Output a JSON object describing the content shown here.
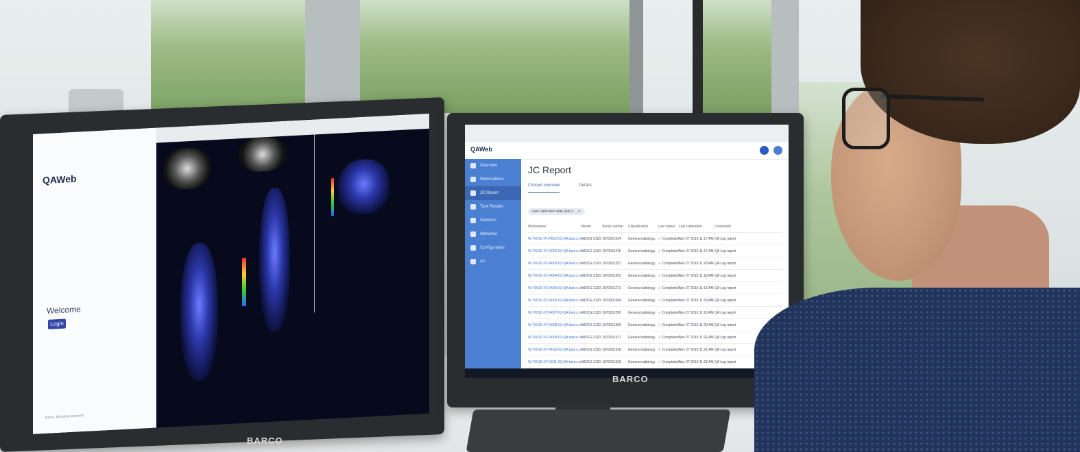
{
  "left_monitor": {
    "app_logo": "QAWeb",
    "welcome": "Welcome",
    "login_button": "Login",
    "footer": "Barco. All rights reserved.",
    "brand": "BARCO"
  },
  "right_monitor": {
    "app_logo": "QAWeb",
    "page_title": "JC Report",
    "brand": "BARCO",
    "tabs": [
      {
        "label": "Content overview"
      },
      {
        "label": "Details"
      }
    ],
    "filter_chip": "Last calibration date (last 3 ... ✕",
    "sidebar": [
      "Overview",
      "Workstations",
      "JC Report",
      "Task Results",
      "Statistics",
      "Networks",
      "Configuration",
      "All"
    ],
    "table": {
      "columns": [
        "Workstation",
        "Model",
        "Serial number",
        "Classification",
        "Last status",
        "Last calibration",
        "Comments"
      ],
      "rows": [
        [
          "W-T001D-0714001-03-QA.barco.org",
          "MDCG-3120",
          "1070001234",
          "General radiology",
          "✓ Completed",
          "Nov 27 2019 11:17 AM",
          "QA Log report"
        ],
        [
          "W-T001D-0714002-03-QA.barco.org",
          "MDCG-3120",
          "1070001240",
          "General radiology",
          "✓ Completed",
          "Nov 27 2019 11:17 AM",
          "QA Log report"
        ],
        [
          "W-T001D-0714003-03-QA.barco.org",
          "MDCG-3120",
          "1070001251",
          "General radiology",
          "✓ Completed",
          "Nov 27 2019 11:18 AM",
          "QA Log report"
        ],
        [
          "W-T001D-0714004-03-QA.barco.org",
          "MDCG-3120",
          "1070001262",
          "General radiology",
          "✓ Completed",
          "Nov 27 2019 11:18 AM",
          "QA Log report"
        ],
        [
          "W-T001D-0714005-03-QA.barco.org",
          "MDCG-3120",
          "1070001273",
          "General radiology",
          "✓ Completed",
          "Nov 27 2019 11:19 AM",
          "QA Log report"
        ],
        [
          "W-T001D-0714006-03-QA.barco.org",
          "MDCG-3120",
          "1070001284",
          "General radiology",
          "✓ Completed",
          "Nov 27 2019 11:19 AM",
          "QA Log report"
        ],
        [
          "W-T001D-0714007-03-QA.barco.org",
          "MDCG-3120",
          "1070001295",
          "General radiology",
          "✓ Completed",
          "Nov 27 2019 11:20 AM",
          "QA Log report"
        ],
        [
          "W-T001D-0714008-03-QA.barco.org",
          "MDCG-3120",
          "1070001306",
          "General radiology",
          "✓ Completed",
          "Nov 27 2019 11:20 AM",
          "QA Log report"
        ],
        [
          "W-T001D-0714009-03-QA.barco.org",
          "MDCG-3120",
          "1070001317",
          "General radiology",
          "✓ Completed",
          "Nov 27 2019 11:21 AM",
          "QA Log report"
        ],
        [
          "W-T001D-0714010-03-QA.barco.org",
          "MDCG-3120",
          "1070001328",
          "General radiology",
          "✓ Completed",
          "Nov 27 2019 11:21 AM",
          "QA Log report"
        ],
        [
          "W-T001D-0714011-03-QA.barco.org",
          "MDCG-3120",
          "1070001339",
          "General radiology",
          "✓ Completed",
          "Nov 27 2019 11:22 AM",
          "QA Log report"
        ]
      ]
    }
  },
  "colors": {
    "sidebar": "#4a7fd1",
    "accent": "#3b67b4",
    "bezel": "#2a2d30",
    "shirt": "#22345a"
  }
}
